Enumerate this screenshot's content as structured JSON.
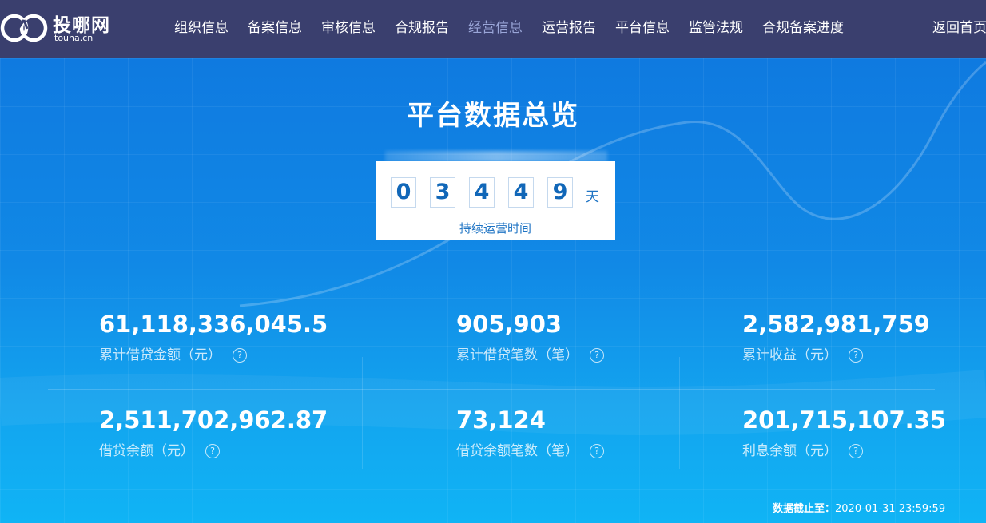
{
  "header": {
    "logo_text": "投哪网",
    "logo_domain": "touna.cn",
    "nav": [
      {
        "label": "组织信息"
      },
      {
        "label": "备案信息"
      },
      {
        "label": "审核信息"
      },
      {
        "label": "合规报告"
      },
      {
        "label": "经营信息",
        "active": true
      },
      {
        "label": "运营报告"
      },
      {
        "label": "平台信息"
      },
      {
        "label": "监管法规"
      },
      {
        "label": "合规备案进度"
      }
    ],
    "back_home": "返回首页"
  },
  "main": {
    "title": "平台数据总览",
    "runtime": {
      "digits": [
        "0",
        "3",
        "4",
        "4",
        "9"
      ],
      "unit": "天",
      "label": "持续运营时间"
    },
    "stats": [
      {
        "value": "61,118,336,045.5",
        "label": "累计借贷金额（元）",
        "icon": "question-icon"
      },
      {
        "value": "905,903",
        "label": "累计借贷笔数（笔）",
        "icon": "question-icon"
      },
      {
        "value": "2,582,981,759",
        "label": "累计收益（元）",
        "icon": "question-icon"
      },
      {
        "value": "2,511,702,962.87",
        "label": "借贷余额（元）",
        "icon": "question-icon"
      },
      {
        "value": "73,124",
        "label": "借贷余额笔数（笔）",
        "icon": "question-icon"
      },
      {
        "value": "201,715,107.35",
        "label": "利息余额（元）",
        "icon": "question-icon"
      }
    ],
    "cutoff_label": "数据截止至：",
    "cutoff_time": "2020-01-31 23:59:59"
  },
  "colors": {
    "header_bg": "#3a3f6e",
    "nav_active": "#9aa6d8",
    "main_bg": "#1189e6",
    "accent_text": "#1f74c4"
  }
}
